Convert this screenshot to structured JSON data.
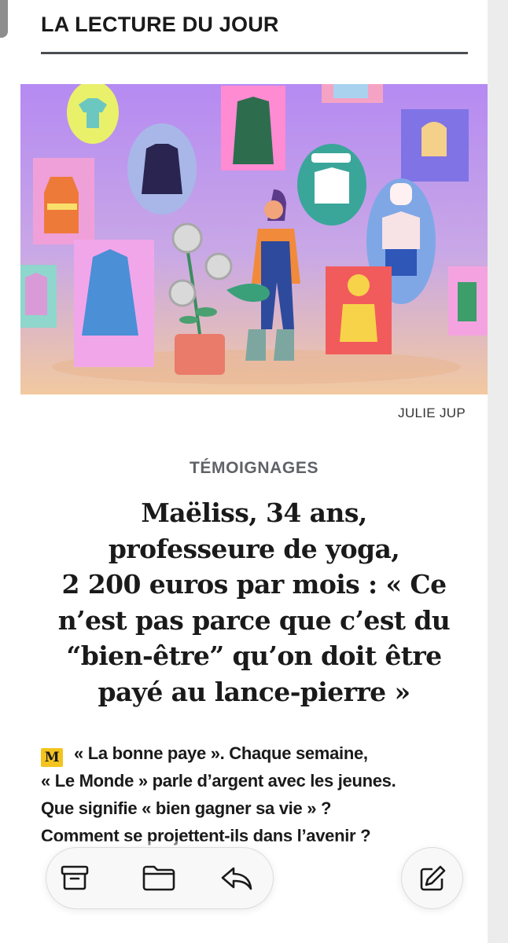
{
  "header": {
    "title": "LA LECTURE DU JOUR"
  },
  "article": {
    "image_credit": "JULIE JUP",
    "kicker": "TÉMOIGNAGES",
    "headline_lines": [
      "Maëliss, 34 ans,",
      "professeure de yoga,",
      "2 200 euros par mois : « Ce",
      "n’est pas parce que c’est du",
      "“bien-être” qu’on doit être",
      "payé au lance-pierre »"
    ],
    "intro_badge": "M",
    "intro_lines": [
      "« La bonne paye ». Chaque semaine,",
      "« Le Monde » parle d’argent avec les jeunes.",
      "Que signifie « bien gagner sa vie » ?",
      "Comment se projettent-ils dans l’avenir ?"
    ]
  },
  "toolbar": {
    "icons": [
      "archive-icon",
      "folder-icon",
      "reply-icon",
      "compose-icon"
    ]
  },
  "colors": {
    "header_rule": "#4a4e52",
    "kicker": "#5f6368",
    "badge": "#f3c420",
    "illustration_top": "#b98bf0",
    "illustration_bottom": "#f3c7a0"
  }
}
